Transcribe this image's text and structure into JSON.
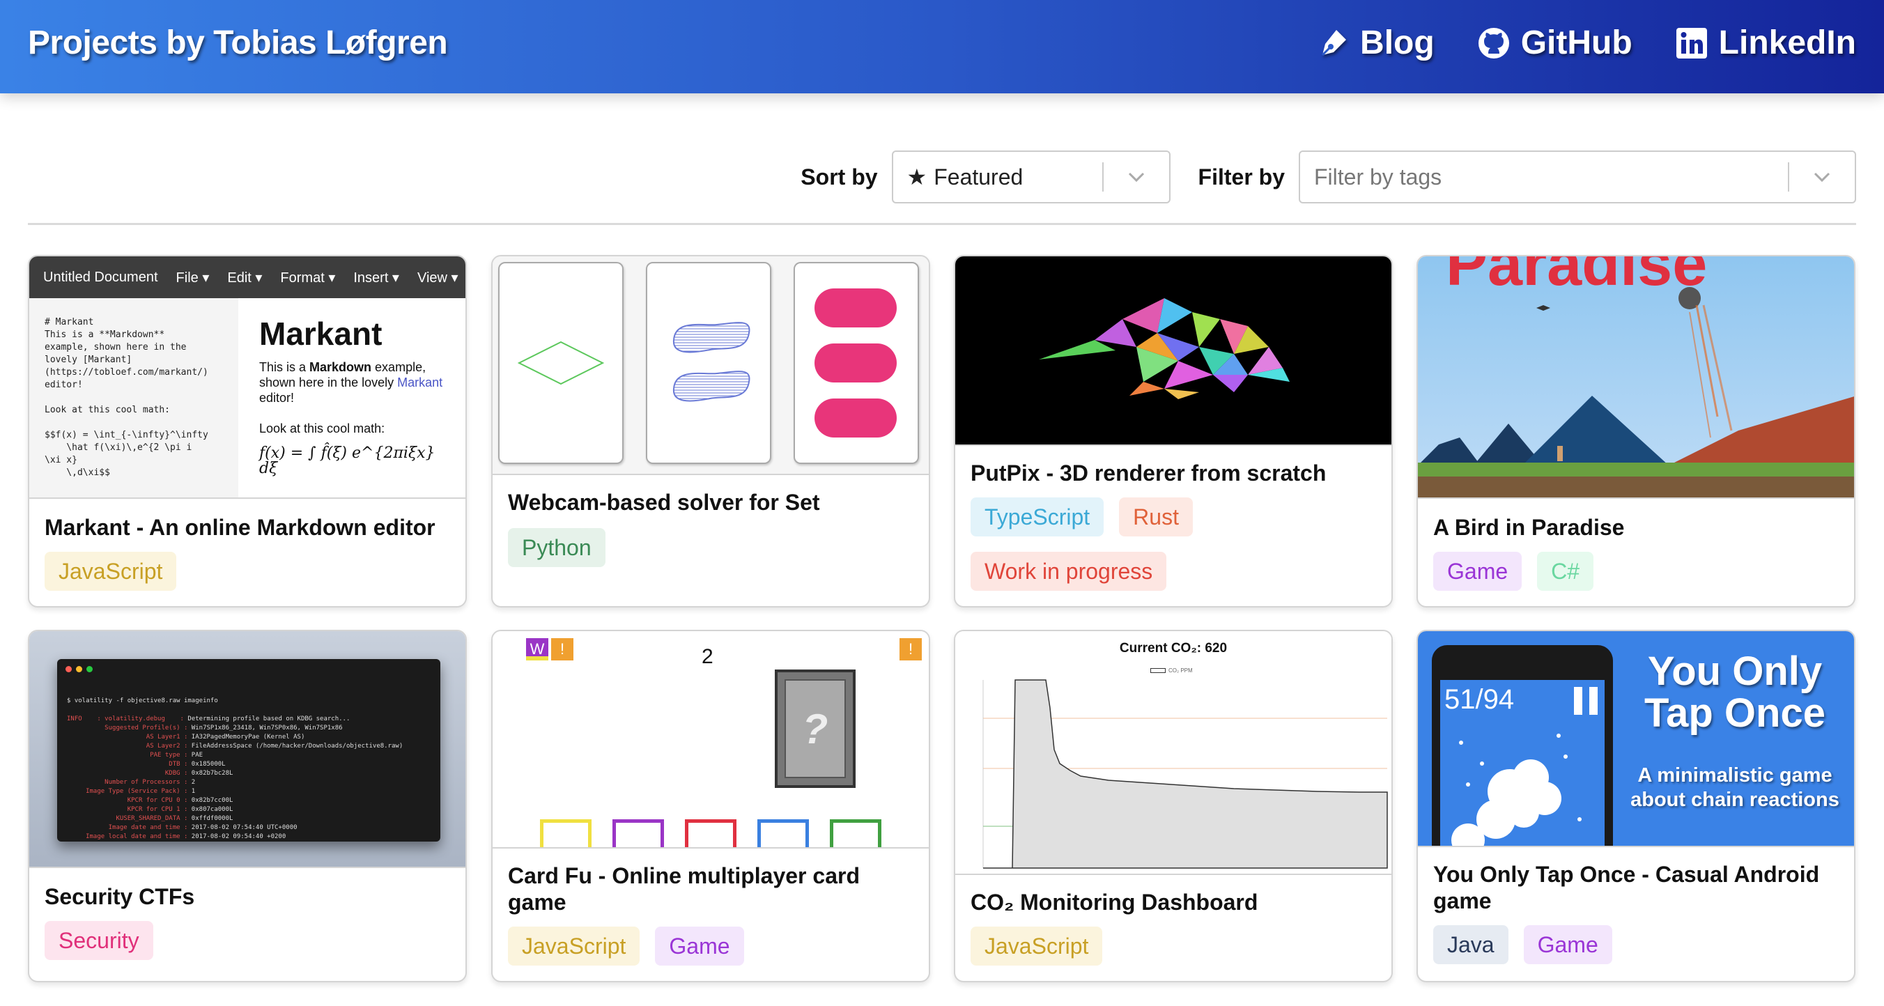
{
  "header": {
    "title": "Projects by Tobias Løfgren",
    "nav": [
      {
        "label": "Blog",
        "icon": "pen-icon"
      },
      {
        "label": "GitHub",
        "icon": "github-icon"
      },
      {
        "label": "LinkedIn",
        "icon": "linkedin-icon"
      }
    ]
  },
  "controls": {
    "sort_label": "Sort by",
    "sort_value": "Featured",
    "filter_label": "Filter by",
    "filter_placeholder": "Filter by tags"
  },
  "cards": [
    {
      "title": "Markant - An online Markdown editor",
      "tags": [
        "JavaScript"
      ]
    },
    {
      "title": "Webcam-based solver for Set",
      "tags": [
        "Python"
      ]
    },
    {
      "title": "PutPix - 3D renderer from scratch",
      "tags": [
        "TypeScript",
        "Rust",
        "Work in progress"
      ]
    },
    {
      "title": "A Bird in Paradise",
      "tags": [
        "Game",
        "C#"
      ]
    },
    {
      "title": "Security CTFs",
      "tags": [
        "Security"
      ]
    },
    {
      "title": "Card Fu - Online multiplayer card game",
      "tags": [
        "JavaScript",
        "Game"
      ]
    },
    {
      "title": "CO₂ Monitoring Dashboard",
      "tags": [
        "JavaScript"
      ]
    },
    {
      "title": "You Only Tap Once - Casual Android game",
      "tags": [
        "Java",
        "Game"
      ]
    }
  ],
  "thumbs": {
    "markant": {
      "menu": [
        "Untitled Document",
        "File ▾",
        "Edit ▾",
        "Format ▾",
        "Insert ▾",
        "View ▾"
      ],
      "heading": "Markant",
      "body_pre": "This is a ",
      "body_bold": "Markdown",
      "body_post": " example, shown here in the lovely ",
      "body_link": "Markant",
      "body_end": " editor!",
      "math_intro": "Look at this cool math:",
      "formula": "f(x) = ∫ f̂(ξ) e^{2πiξx} dξ"
    },
    "cardfu": {
      "counter": "2",
      "badge": "W",
      "mark": "!",
      "card_mark": "?"
    },
    "co2": {
      "chart_title": "Current CO₂: 620",
      "legend": "CO₂ PPM"
    },
    "yoto": {
      "score": "51/94",
      "headline": "You Only Tap Once",
      "subtitle": "A minimalistic game about chain reactions"
    },
    "bird": {
      "banner": "Paradise"
    }
  },
  "tag_colors": {
    "JavaScript": {
      "bg": "#fbf4dd",
      "fg": "#c8a025"
    },
    "Python": {
      "bg": "#e6f2ea",
      "fg": "#3a8a55"
    },
    "TypeScript": {
      "bg": "#e2f3fa",
      "fg": "#3ba9d6"
    },
    "Rust": {
      "bg": "#fde9e3",
      "fg": "#e0623a"
    },
    "Work in progress": {
      "bg": "#fde6e2",
      "fg": "#e0453a"
    },
    "Game": {
      "bg": "#f3e6fc",
      "fg": "#9a35d6"
    },
    "C#": {
      "bg": "#e6faee",
      "fg": "#6ad7a0"
    },
    "Security": {
      "bg": "#fde4ee",
      "fg": "#e0307a"
    },
    "Java": {
      "bg": "#e6ebf2",
      "fg": "#2a3a5a"
    }
  }
}
